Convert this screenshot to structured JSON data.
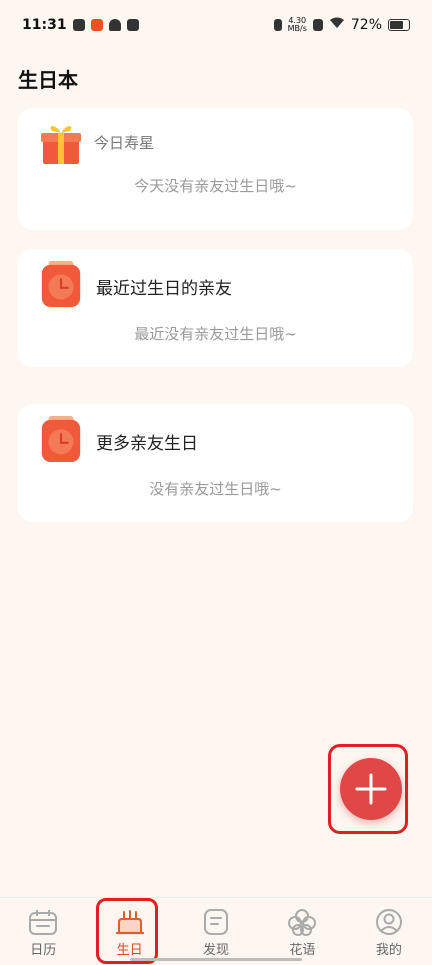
{
  "status_bar": {
    "time": "11:31",
    "net_speed_top": "4.30",
    "net_speed_bottom": "MB/s",
    "battery": "72%"
  },
  "page": {
    "title": "生日本"
  },
  "cards": {
    "today": {
      "title": "今日寿星",
      "empty": "今天没有亲友过生日哦~"
    },
    "recent": {
      "title": "最近过生日的亲友",
      "empty": "最近没有亲友过生日哦~"
    },
    "more": {
      "title": "更多亲友生日",
      "empty": "没有亲友过生日哦~"
    }
  },
  "fab": {
    "icon": "plus-icon"
  },
  "tabs": [
    {
      "label": "日历",
      "icon": "calendar-icon"
    },
    {
      "label": "生日",
      "icon": "cake-icon"
    },
    {
      "label": "发现",
      "icon": "discover-icon"
    },
    {
      "label": "花语",
      "icon": "flower-icon"
    },
    {
      "label": "我的",
      "icon": "profile-icon"
    }
  ],
  "colors": {
    "accent": "#d94a2a",
    "fab": "#e04848",
    "background": "#fdf6f1"
  }
}
